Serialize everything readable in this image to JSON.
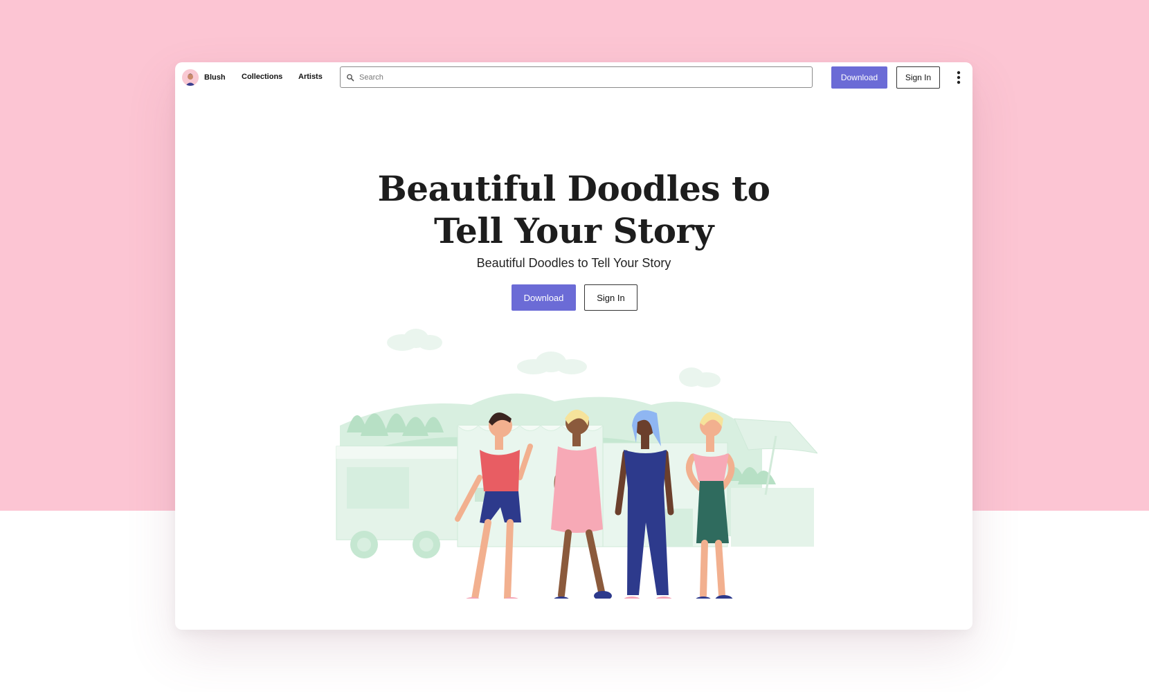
{
  "nav": {
    "brand": "Blush",
    "links": [
      "Collections",
      "Artists"
    ],
    "search_placeholder": "Search",
    "download_label": "Download",
    "signin_label": "Sign In"
  },
  "hero": {
    "title_line1": "Beautiful Doodles to",
    "title_line2": "Tell Your Story",
    "subtitle": "Beautiful Doodles to Tell Your Story",
    "download_label": "Download",
    "signin_label": "Sign In"
  },
  "colors": {
    "page_background": "#fcc5d3",
    "accent": "#6b6bd6",
    "illustration_green": "#b7e0c5"
  },
  "icons": [
    "search-icon",
    "more-vertical-icon"
  ]
}
